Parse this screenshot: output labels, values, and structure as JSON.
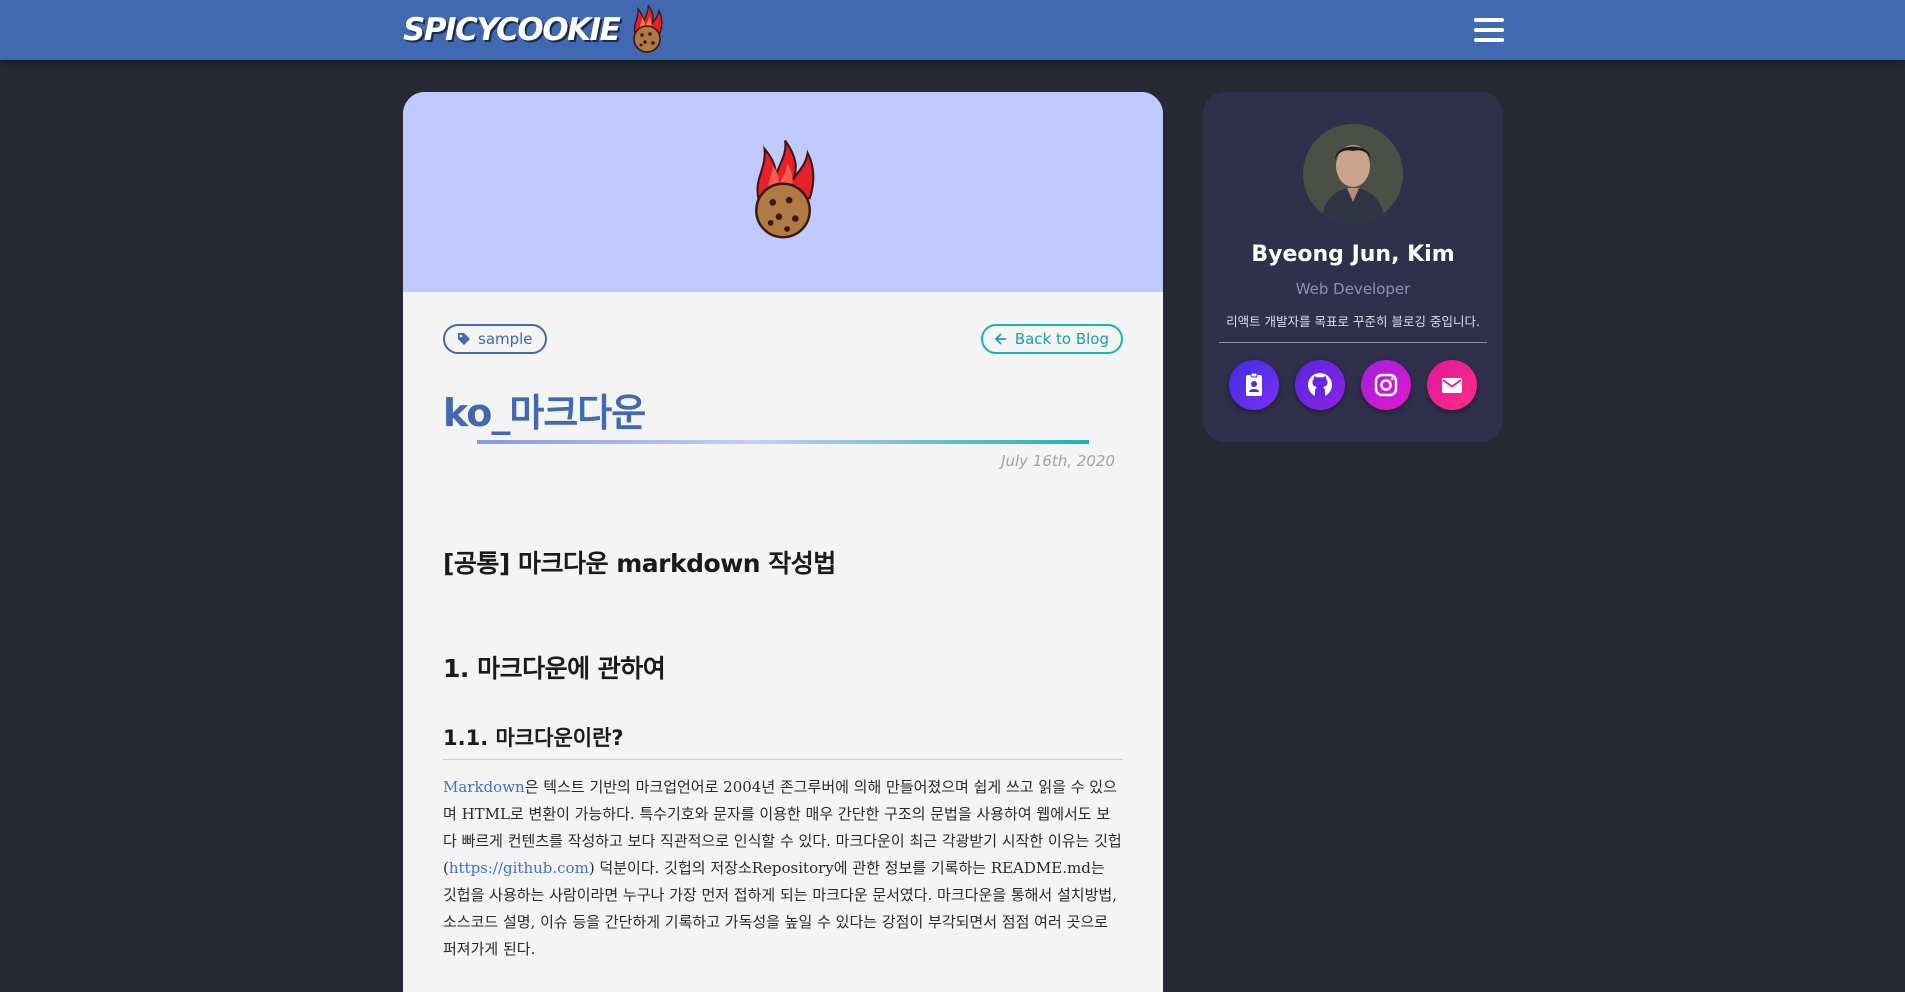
{
  "header": {
    "logo_text": "SPICYCOOKIE",
    "menu_icon": "hamburger-menu-icon",
    "bg_color": "#4069b1"
  },
  "post": {
    "tag": "sample",
    "back_label": "Back to Blog",
    "title": "ko_마크다운",
    "date": "July 16th, 2020",
    "h1": "[공통] 마크다운 markdown 작성법",
    "h2": "1. 마크다운에 관하여",
    "h3": "1.1. 마크다운이란?",
    "para_link1": "Markdown",
    "para_text1": "은 텍스트 기반의 마크업언어로 2004년 존그루버에 의해 만들어졌으며 쉽게 쓰고 읽을 수 있으며 HTML로 변환이 가능하다. 특수기호와 문자를 이용한 매우 간단한 구조의 문법을 사용하여 웹에서도 보다 빠르게 컨텐츠를 작성하고 보다 직관적으로 인식할 수 있다. 마크다운이 최근 각광받기 시작한 이유는 깃헙(",
    "para_link2": "https://github.com",
    "para_text2": ") 덕분이다. 깃헙의 저장소Repository에 관한 정보를 기록하는 README.md는 깃헙을 사용하는 사람이라면 누구나 가장 먼저 접하게 되는 마크다운 문서였다. 마크다운을 통해서 설치방법, 소스코드 설명, 이슈 등을 간단하게 기록하고 가독성을 높일 수 있다는 강점이 부각되면서 점점 여러 곳으로 퍼져가게 된다.",
    "accent_color": "#4069b1",
    "teal_color": "#16b5b8"
  },
  "profile": {
    "name": "Byeong Jun, Kim",
    "role": "Web Developer",
    "description": "리액트 개발자를 목표로 꾸준히 블로깅 중입니다.",
    "socials": [
      {
        "icon": "contact-badge-icon"
      },
      {
        "icon": "github-icon"
      },
      {
        "icon": "instagram-icon"
      },
      {
        "icon": "email-icon"
      }
    ]
  }
}
